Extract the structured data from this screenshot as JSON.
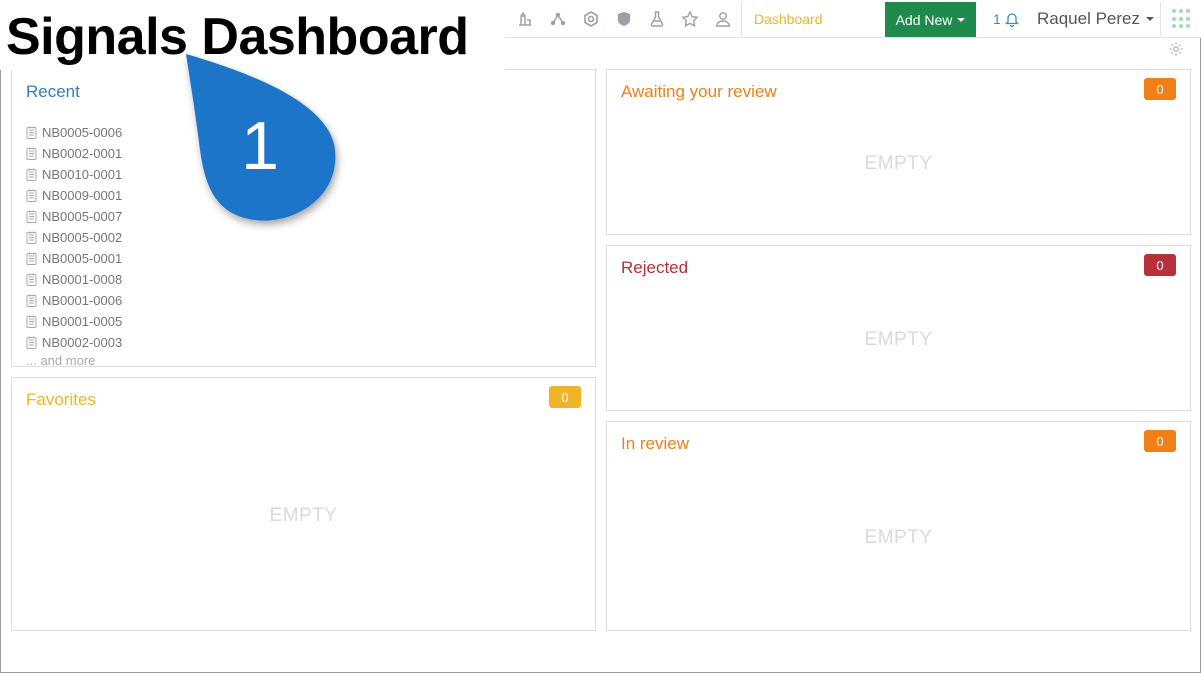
{
  "page_title": "Signals Dashboard",
  "nav": {
    "icons": [
      "beaker-stand-icon",
      "molecule-icon",
      "hexagon-icon",
      "flask-shield-icon",
      "flask-icon",
      "star-icon",
      "user-outline-icon"
    ],
    "dashboard_label": "Dashboard",
    "add_new_label": "Add New",
    "notification_count": "1",
    "user_name": "Raquel Perez"
  },
  "panels": {
    "recent": {
      "title": "Recent",
      "items": [
        "NB0005-0006",
        "NB0002-0001",
        "NB0010-0001",
        "NB0009-0001",
        "NB0005-0007",
        "NB0005-0002",
        "NB0005-0001",
        "NB0001-0008",
        "NB0001-0006",
        "NB0001-0005",
        "NB0002-0003"
      ],
      "more_label": "... and more"
    },
    "favorites": {
      "title": "Favorites",
      "count": "0",
      "empty": "EMPTY"
    },
    "awaiting": {
      "title": "Awaiting your review",
      "count": "0",
      "empty": "EMPTY"
    },
    "rejected": {
      "title": "Rejected",
      "count": "0",
      "empty": "EMPTY"
    },
    "in_review": {
      "title": "In review",
      "count": "0",
      "empty": "EMPTY"
    }
  },
  "callout": {
    "number": "1"
  },
  "colors": {
    "blue_title": "#2f7fc1",
    "favorites": "#f0b429",
    "orange": "#f07f1a",
    "rejected": "#b7303a",
    "add_new_bg": "#1e8a4c",
    "callout": "#1b74c9"
  }
}
